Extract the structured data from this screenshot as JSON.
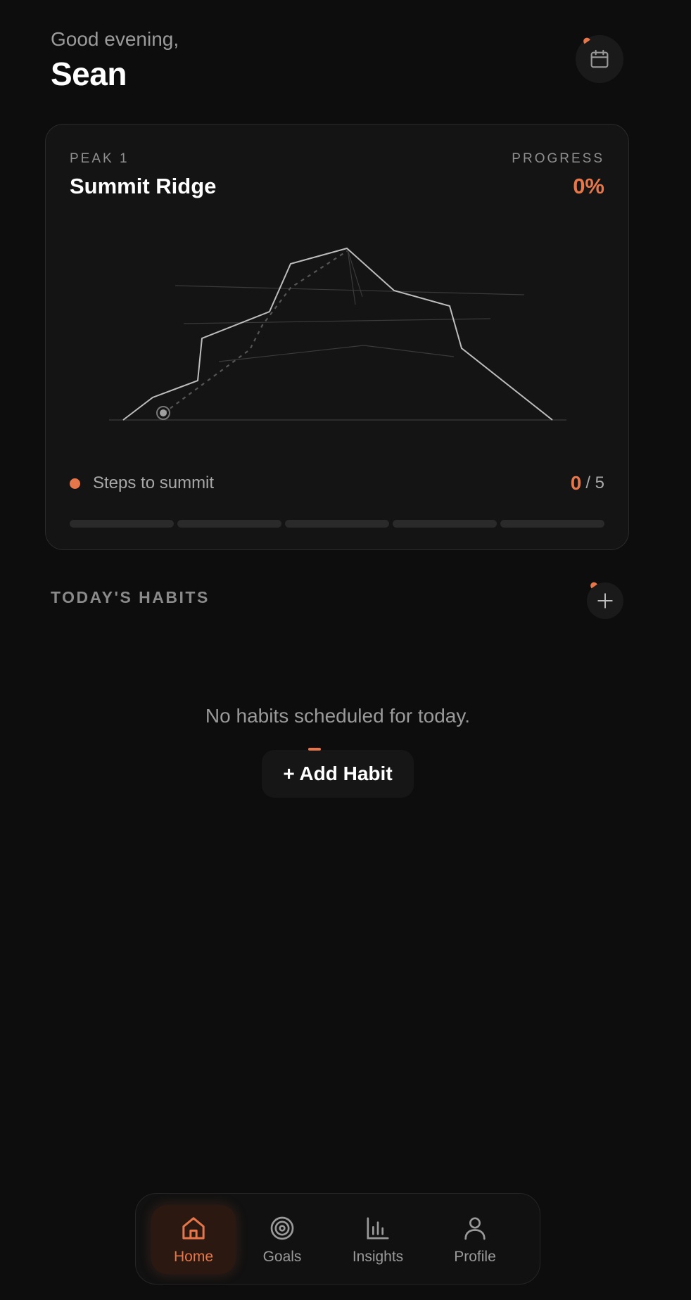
{
  "header": {
    "greeting": "Good evening,",
    "name": "Sean",
    "calendar_icon": "calendar-icon"
  },
  "peak_card": {
    "peak_label": "PEAK 1",
    "peak_name": "Summit Ridge",
    "progress_label": "PROGRESS",
    "progress_value": "0%",
    "steps_label": "Steps to summit",
    "steps_done": "0",
    "steps_total": "/ 5",
    "segments_total": 5,
    "segments_completed": 0,
    "accent_color": "#e7774a"
  },
  "habits": {
    "section_title": "TODAY'S HABITS",
    "add_icon": "plus-icon",
    "empty_message": "No habits scheduled for today.",
    "add_button_label": "+ Add Habit"
  },
  "nav": {
    "items": [
      {
        "label": "Home",
        "icon": "home-icon",
        "active": true
      },
      {
        "label": "Goals",
        "icon": "target-icon",
        "active": false
      },
      {
        "label": "Insights",
        "icon": "bar-chart-icon",
        "active": false
      },
      {
        "label": "Profile",
        "icon": "user-icon",
        "active": false
      }
    ]
  }
}
